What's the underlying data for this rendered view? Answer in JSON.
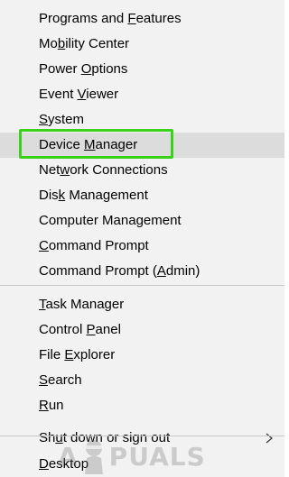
{
  "menu": {
    "items": [
      {
        "name": "menu-item-programs-and-features",
        "before": "Programs and ",
        "key": "F",
        "after": "eatures"
      },
      {
        "name": "menu-item-mobility-center",
        "before": "Mo",
        "key": "b",
        "after": "ility Center"
      },
      {
        "name": "menu-item-power-options",
        "before": "Power ",
        "key": "O",
        "after": "ptions"
      },
      {
        "name": "menu-item-event-viewer",
        "before": "Event ",
        "key": "V",
        "after": "iewer"
      },
      {
        "name": "menu-item-system",
        "before": "",
        "key": "S",
        "after": "ystem"
      },
      {
        "name": "menu-item-device-manager",
        "before": "Device ",
        "key": "M",
        "after": "anager"
      },
      {
        "name": "menu-item-network-connections",
        "before": "Net",
        "key": "w",
        "after": "ork Connections"
      },
      {
        "name": "menu-item-disk-management",
        "before": "Dis",
        "key": "k",
        "after": " Management"
      },
      {
        "name": "menu-item-computer-management",
        "before": "Computer Mana",
        "key": "g",
        "after": "ement"
      },
      {
        "name": "menu-item-command-prompt",
        "before": "",
        "key": "C",
        "after": "ommand Prompt"
      },
      {
        "name": "menu-item-command-prompt-admin",
        "before": "Command Prompt (",
        "key": "A",
        "after": "dmin)"
      },
      {
        "name": "menu-item-task-manager",
        "before": "",
        "key": "T",
        "after": "ask Manager"
      },
      {
        "name": "menu-item-control-panel",
        "before": "Control ",
        "key": "P",
        "after": "anel"
      },
      {
        "name": "menu-item-file-explorer",
        "before": "File ",
        "key": "E",
        "after": "xplorer"
      },
      {
        "name": "menu-item-search",
        "before": "",
        "key": "S",
        "after": "earch"
      },
      {
        "name": "menu-item-run",
        "before": "",
        "key": "R",
        "after": "un"
      },
      {
        "name": "menu-item-shut-down-or-sign-out",
        "before": "Sh",
        "key": "u",
        "after": "t down or sign out"
      },
      {
        "name": "menu-item-desktop",
        "before": "",
        "key": "D",
        "after": "esktop"
      }
    ],
    "selected": "Device Manager"
  },
  "watermark": {
    "text_left": "A",
    "text_right": "PUALS"
  },
  "colors": {
    "menu_background": "#f2f2f2",
    "selected_background": "#dcdcdc",
    "highlight_border": "#39d11a",
    "divider": "#c8c8c8"
  }
}
